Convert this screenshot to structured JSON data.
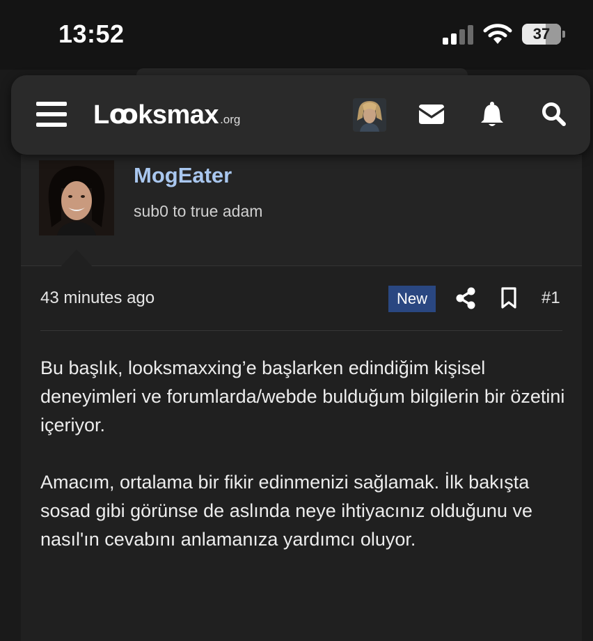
{
  "status_bar": {
    "time": "13:52",
    "battery": "37"
  },
  "header": {
    "logo_main": "Lꝏksmax",
    "logo_tld": ".org",
    "icons": [
      "menu-icon",
      "user-avatar",
      "envelope-icon",
      "bell-icon",
      "search-icon"
    ]
  },
  "post": {
    "username": "MogEater",
    "user_title": "sub0 to true adam",
    "timestamp": "43 minutes ago",
    "badge": "New",
    "post_number": "#1",
    "paragraphs": [
      "Bu başlık, looksmaxxing’e başlarken edindiğim kişisel deneyimleri ve forumlarda/webde bulduğum bilgilerin bir özetini içeriyor.",
      "Amacım, ortalama bir fikir edinmenizi sağlamak. İlk bakışta sosad gibi görünse de aslında neye ihtiyacınız olduğunu ve nasıl'ın cevabını anlamanıza yardımcı oluyor."
    ]
  },
  "colors": {
    "background": "#1a1a1a",
    "header_bg": "#2a2a2a",
    "username": "#a9c7ef",
    "badge_bg": "#2a4781"
  }
}
